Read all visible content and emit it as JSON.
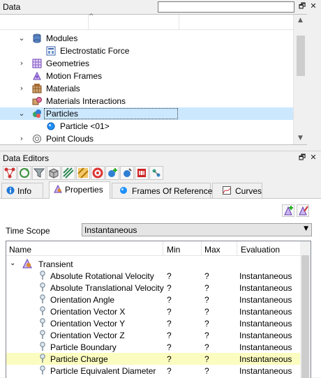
{
  "data_panel": {
    "title": "Data",
    "search": {
      "value": "",
      "placeholder": ""
    },
    "tree": [
      {
        "label": "Modules",
        "expanded": true,
        "icon": "database-icon",
        "level": 0
      },
      {
        "label": "Electrostatic Force",
        "icon": "module-grid-icon",
        "level": 1
      },
      {
        "label": "Geometries",
        "expanded": false,
        "icon": "geometry-icon",
        "level": 0
      },
      {
        "label": "Motion Frames",
        "expanded": false,
        "icon": "motion-frames-icon",
        "level": 0
      },
      {
        "label": "Materials",
        "expanded": false,
        "icon": "materials-icon",
        "level": 0
      },
      {
        "label": "Materials Interactions",
        "icon": "material-interactions-icon",
        "level": 0
      },
      {
        "label": "Particles",
        "expanded": true,
        "selected": true,
        "icon": "particles-icon",
        "level": 0
      },
      {
        "label": "Particle <01>",
        "icon": "particle-dot-icon",
        "level": 1
      },
      {
        "label": "Point Clouds",
        "expanded": false,
        "icon": "point-clouds-icon",
        "level": 0
      }
    ]
  },
  "editors_panel": {
    "title": "Data Editors",
    "toolbar_icons": [
      "network-icon",
      "refresh-icon",
      "filter-icon",
      "box-icon",
      "stripes-icon",
      "hatch-icon",
      "ring-icon",
      "add-sphere-icon",
      "sphere-icon",
      "sync-icon",
      "robot-icon",
      "dots-icon"
    ],
    "tabs": [
      {
        "label": "Info",
        "icon": "info-icon"
      },
      {
        "label": "Properties",
        "icon": "properties-icon",
        "active": true
      },
      {
        "label": "Frames Of Reference",
        "icon": "frames-icon"
      },
      {
        "label": "Curves",
        "icon": "curves-icon"
      }
    ],
    "time_scope": {
      "label": "Time Scope",
      "value": "Instantaneous"
    },
    "grid": {
      "columns": [
        "Name",
        "Min",
        "Max",
        "Evaluation"
      ],
      "group": "Transient",
      "rows": [
        {
          "name": "Absolute Rotational Velocity",
          "min": "?",
          "max": "?",
          "evaluation": "Instantaneous"
        },
        {
          "name": "Absolute Translational Velocity",
          "min": "?",
          "max": "?",
          "evaluation": "Instantaneous"
        },
        {
          "name": "Orientation Angle",
          "min": "?",
          "max": "?",
          "evaluation": "Instantaneous"
        },
        {
          "name": "Orientation Vector X",
          "min": "?",
          "max": "?",
          "evaluation": "Instantaneous"
        },
        {
          "name": "Orientation Vector Y",
          "min": "?",
          "max": "?",
          "evaluation": "Instantaneous"
        },
        {
          "name": "Orientation Vector Z",
          "min": "?",
          "max": "?",
          "evaluation": "Instantaneous"
        },
        {
          "name": "Particle Boundary",
          "min": "?",
          "max": "?",
          "evaluation": "Instantaneous"
        },
        {
          "name": "Particle Charge",
          "min": "?",
          "max": "?",
          "evaluation": "Instantaneous",
          "highlighted": true
        },
        {
          "name": "Particle Equivalent Diameter",
          "min": "?",
          "max": "?",
          "evaluation": "Instantaneous"
        }
      ]
    }
  },
  "colors": {
    "selection": "#cce8ff",
    "row_highlight": "#fbfcbf",
    "accent_blue": "#0078d7"
  }
}
